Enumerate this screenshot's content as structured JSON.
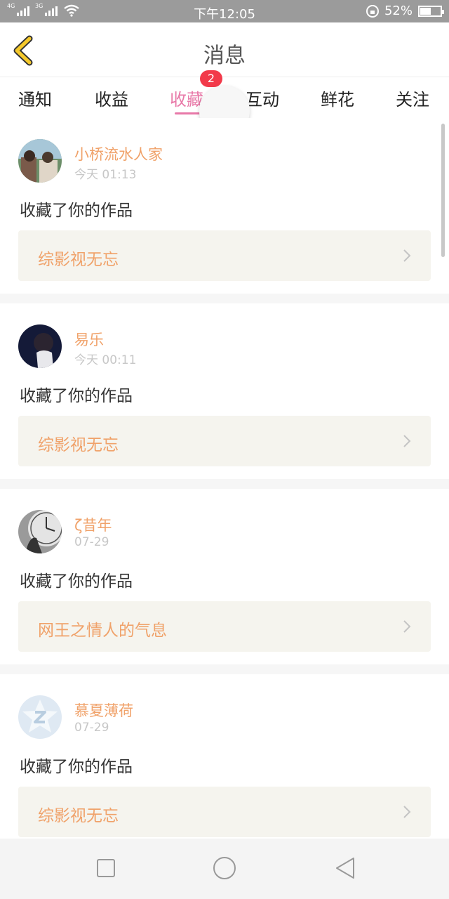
{
  "status_bar": {
    "left_signals": [
      "4G",
      "3G"
    ],
    "time": "下午12:05",
    "battery_percent": "52%",
    "battery_level": 0.52
  },
  "header": {
    "title": "消息",
    "back_icon": "chevron-left-icon",
    "accent_color": "#f5c92b"
  },
  "tabs": {
    "items": [
      "通知",
      "收益",
      "收藏",
      "互动",
      "鲜花",
      "关注"
    ],
    "active_index": 2,
    "badge": "2"
  },
  "messages": [
    {
      "user": "小桥流水人家",
      "time": "今天 01:13",
      "action": "收藏了你的作品",
      "work_title": "综影视无忘"
    },
    {
      "user": "易乐",
      "time": "今天 00:11",
      "action": "收藏了你的作品",
      "work_title": "综影视无忘"
    },
    {
      "user": "ζ昔年",
      "time": "07-29",
      "action": "收藏了你的作品",
      "work_title": "网王之情人的气息"
    },
    {
      "user": "慕夏薄荷",
      "time": "07-29",
      "action": "收藏了你的作品",
      "work_title": "综影视无忘"
    }
  ],
  "colors": {
    "accent_pink": "#e879a8",
    "name_orange": "#f0a26a",
    "badge_red": "#f23a4a"
  }
}
